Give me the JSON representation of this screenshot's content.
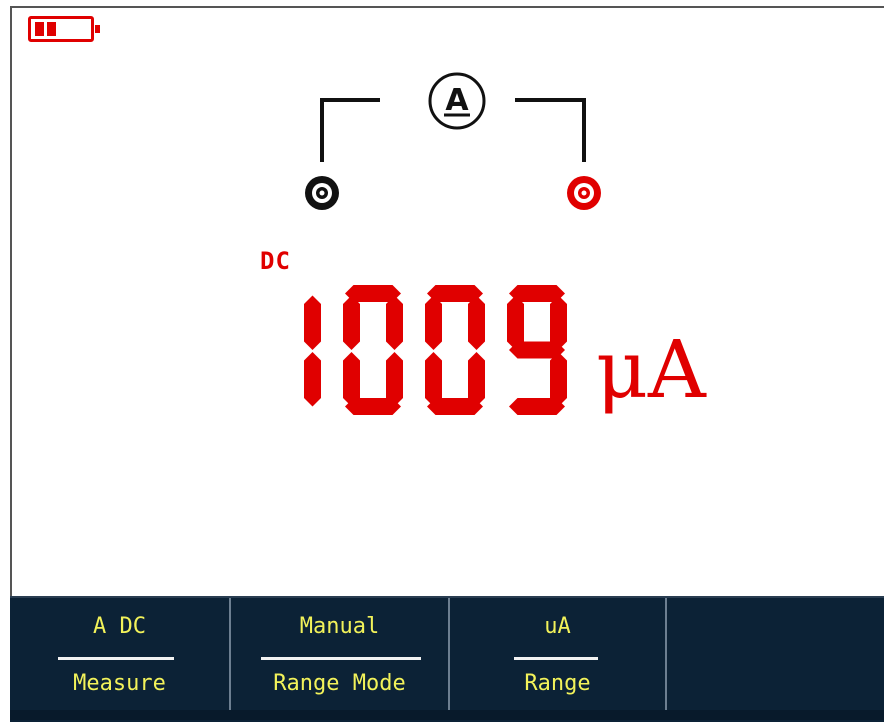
{
  "display": {
    "coupling": "DC",
    "reading": "1009",
    "unit": "μA",
    "terminal_icon": "ammeter-icon",
    "terminal_letter": "A",
    "colors": {
      "reading": "#e00000",
      "wiring": "#111111",
      "common_terminal": "#111111",
      "input_terminal": "#e00000"
    }
  },
  "battery": {
    "icon": "battery-icon",
    "level_fraction": 0.4,
    "color": "#e00000"
  },
  "softkeys": [
    {
      "value": "A DC",
      "label": "Measure"
    },
    {
      "value": "Manual",
      "label": "Range Mode"
    },
    {
      "value": "uA",
      "label": "Range"
    }
  ],
  "softkey_colors": {
    "background": "#0c2236",
    "text": "#f2f25a",
    "divider": "#f2f2f2"
  }
}
